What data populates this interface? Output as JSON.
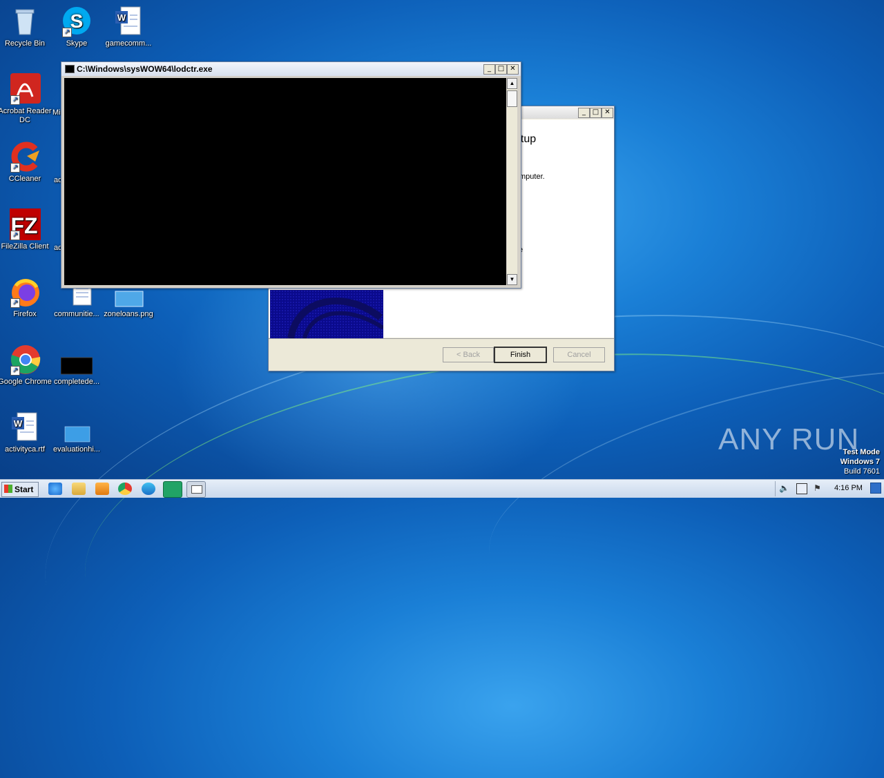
{
  "desktop_icons": [
    {
      "label": "Recycle Bin",
      "icon": "recycle-bin-icon"
    },
    {
      "label": "Skype",
      "icon": "skype-icon"
    },
    {
      "label": "gamecomm...",
      "icon": "word-document-icon"
    },
    {
      "label": "Acrobat Reader DC",
      "icon": "acrobat-icon"
    },
    {
      "label": "Mi",
      "icon": "generic-icon"
    },
    {
      "label": "CCleaner",
      "icon": "ccleaner-icon"
    },
    {
      "label": "ad",
      "icon": "generic-icon"
    },
    {
      "label": "FileZilla Client",
      "icon": "filezilla-icon"
    },
    {
      "label": "ad",
      "icon": "generic-icon"
    },
    {
      "label": "Firefox",
      "icon": "firefox-icon"
    },
    {
      "label": "communitie...",
      "icon": "document-icon"
    },
    {
      "label": "zoneloans.png",
      "icon": "image-file-icon"
    },
    {
      "label": "Google Chrome",
      "icon": "chrome-icon"
    },
    {
      "label": "completede...",
      "icon": "black-thumbnail-icon"
    },
    {
      "label": "activityca.rtf",
      "icon": "word-document-icon"
    },
    {
      "label": "evaluationhi...",
      "icon": "image-file-icon"
    }
  ],
  "setup_window": {
    "title_partial": "etup",
    "text_partial": "mputer.",
    "text_partial2": "e",
    "buttons": {
      "back": "< Back",
      "finish": "Finish",
      "cancel": "Cancel"
    }
  },
  "console_window": {
    "title": "C:\\Windows\\sysWOW64\\lodctr.exe",
    "controls": {
      "minimize": "_",
      "maximize": "□",
      "close": "✕"
    }
  },
  "taskbar": {
    "start_label": "Start",
    "apps": [
      "ie-icon",
      "explorer-icon",
      "media-player-icon",
      "chrome-icon",
      "edge-icon",
      "app-green-icon",
      "console-icon"
    ],
    "clock": "4:16 PM"
  },
  "watermark": {
    "brand": "ANY RUN",
    "line1": "Test Mode",
    "line2": "Windows 7",
    "line3": "Build 7601"
  }
}
